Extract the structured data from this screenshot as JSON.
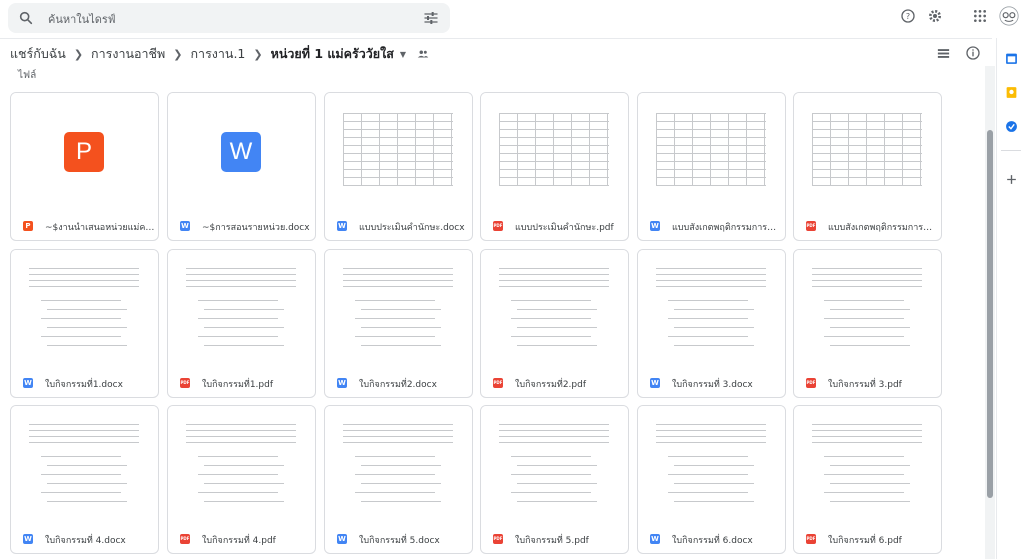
{
  "search": {
    "placeholder": "ค้นหาในไดรฟ์"
  },
  "breadcrumb": {
    "items": [
      "แชร์กับฉัน",
      "การงานอาชีพ",
      "การงาน.1"
    ],
    "current": "หน่วยที่ 1 แม่ครัววัยใส"
  },
  "section": {
    "files_label": "ไฟล์"
  },
  "files": [
    {
      "name": "~$งานนำเสนอหน่วยแม่ครัววัย...",
      "type": "pptx",
      "icon": "P"
    },
    {
      "name": "~$การสอนรายหน่วย.docx",
      "type": "docx",
      "icon": "W"
    },
    {
      "name": "แบบประเมินคำนักษะ.docx",
      "type": "docx",
      "icon": "W"
    },
    {
      "name": "แบบประเมินคำนักษะ.pdf",
      "type": "pdf",
      "icon": "PDF"
    },
    {
      "name": "แบบสังเกตพฤติกรรมการทำงา...",
      "type": "docx",
      "icon": "W"
    },
    {
      "name": "แบบสังเกตพฤติกรรมการทำงา...",
      "type": "pdf",
      "icon": "PDF"
    },
    {
      "name": "ใบกิจกรรมที่1.docx",
      "type": "docx",
      "icon": "W"
    },
    {
      "name": "ใบกิจกรรมที่1.pdf",
      "type": "pdf",
      "icon": "PDF"
    },
    {
      "name": "ใบกิจกรรมที่2.docx",
      "type": "docx",
      "icon": "W"
    },
    {
      "name": "ใบกิจกรรมที่2.pdf",
      "type": "pdf",
      "icon": "PDF"
    },
    {
      "name": "ใบกิจกรรมที่ 3.docx",
      "type": "docx",
      "icon": "W"
    },
    {
      "name": "ใบกิจกรรมที่ 3.pdf",
      "type": "pdf",
      "icon": "PDF"
    },
    {
      "name": "ใบกิจกรรมที่ 4.docx",
      "type": "docx",
      "icon": "W"
    },
    {
      "name": "ใบกิจกรรมที่ 4.pdf",
      "type": "pdf",
      "icon": "PDF"
    },
    {
      "name": "ใบกิจกรรมที่ 5.docx",
      "type": "docx",
      "icon": "W"
    },
    {
      "name": "ใบกิจกรรมที่ 5.pdf",
      "type": "pdf",
      "icon": "PDF"
    },
    {
      "name": "ใบกิจกรรมที่ 6.docx",
      "type": "docx",
      "icon": "W"
    },
    {
      "name": "ใบกิจกรรมที่ 6.pdf",
      "type": "pdf",
      "icon": "PDF"
    }
  ],
  "big_icons": {
    "pptx_letter": "P",
    "docx_letter": "W"
  },
  "colors": {
    "pptx": "#f4511e",
    "docx": "#4285f4",
    "pdf": "#ea4335"
  }
}
